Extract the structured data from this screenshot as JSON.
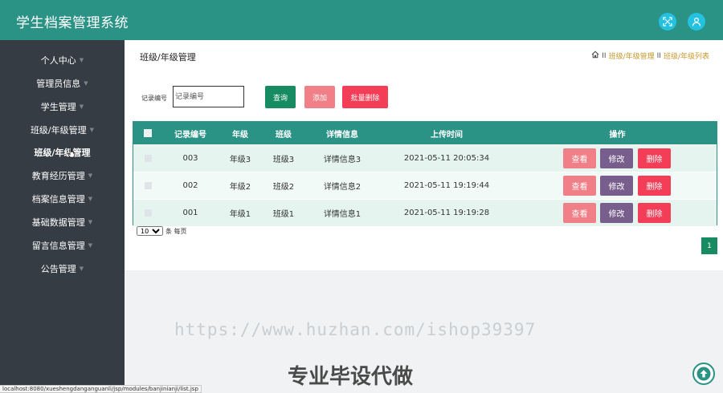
{
  "header": {
    "title": "学生档案管理系统",
    "fullscreen_icon": "fullscreen-icon",
    "user_icon": "user-icon",
    "accent_color": "#2b9286"
  },
  "sidebar": {
    "items": [
      {
        "label": "个人中心"
      },
      {
        "label": "管理员信息"
      },
      {
        "label": "学生管理"
      },
      {
        "label": "班级/年级管理"
      },
      {
        "label": "班级/年级管理",
        "active_sub": true
      },
      {
        "label": "教育经历管理"
      },
      {
        "label": "档案信息管理"
      },
      {
        "label": "基础数据管理"
      },
      {
        "label": "留言信息管理"
      },
      {
        "label": "公告管理"
      }
    ]
  },
  "main": {
    "page_title": "班级/年级管理",
    "breadcrumb": {
      "home_icon": "home-icon",
      "sep1": "II",
      "item1": "班级/年级管理",
      "sep2": "II",
      "item2": "班级/年级列表"
    },
    "search": {
      "label": "记录编号",
      "placeholder": "记录编号",
      "value": ""
    },
    "buttons": {
      "query": "查询",
      "add": "添加",
      "batch_delete": "批量删除"
    },
    "table": {
      "columns": [
        "记录编号",
        "年级",
        "班级",
        "详情信息",
        "上传时间",
        "操作"
      ],
      "rows": [
        {
          "id": "003",
          "grade": "年级3",
          "class": "班级3",
          "detail": "详情信息3",
          "time": "2021-05-11 20:05:34"
        },
        {
          "id": "002",
          "grade": "年级2",
          "class": "班级2",
          "detail": "详情信息2",
          "time": "2021-05-11 19:19:44"
        },
        {
          "id": "001",
          "grade": "年级1",
          "class": "班级1",
          "detail": "详情信息1",
          "time": "2021-05-11 19:19:28"
        }
      ],
      "actions": {
        "view": "查看",
        "edit": "修改",
        "delete": "删除"
      }
    },
    "pager": {
      "page_size": "10",
      "page_size_suffix": "条 每页",
      "current_page": "1"
    }
  },
  "overlay": {
    "watermark": "https://www.huzhan.com/ishop39397",
    "promo": "专业毕设代做",
    "status_url": "localhost:8080/xueshengdanganguanli/jsp/modules/banjinianji/list.jsp"
  },
  "colors": {
    "teal": "#2b9286",
    "sidebar": "#353c43",
    "green_button": "#178c63",
    "pink_button": "#f07f87",
    "red_button": "#f43d56",
    "purple_button": "#775e8c"
  }
}
